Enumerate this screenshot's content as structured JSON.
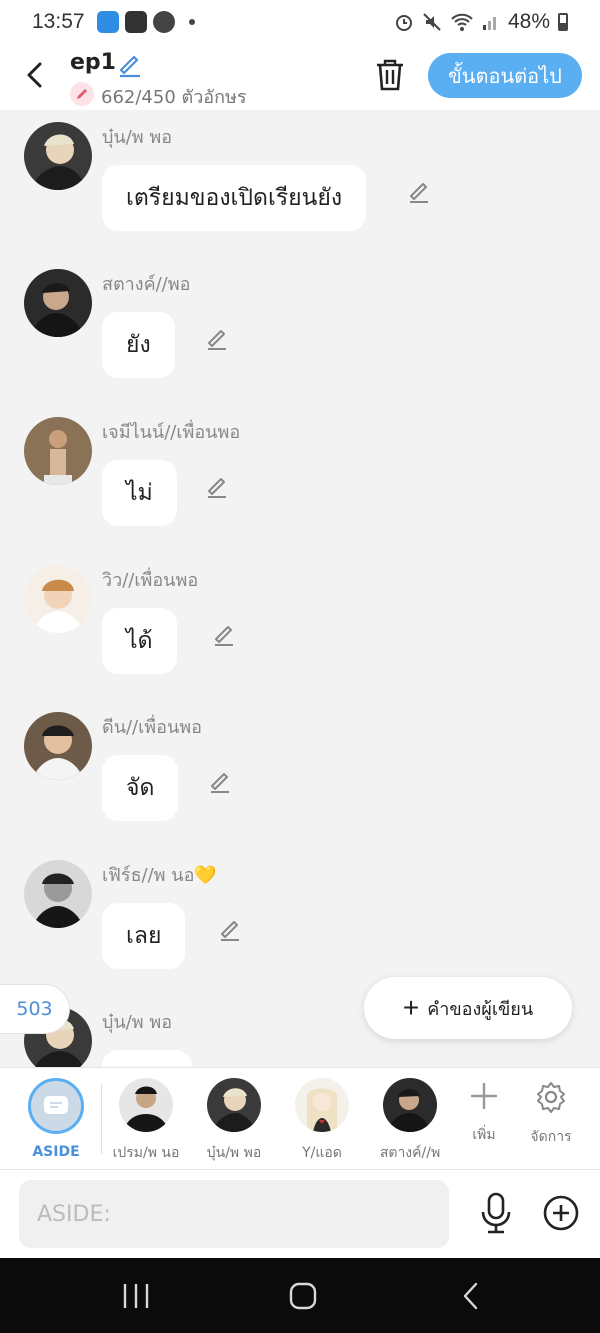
{
  "status_bar": {
    "time": "13:57",
    "battery": "48%"
  },
  "header": {
    "title": "ep1",
    "char_count": "662/450 ตัวอักษร",
    "next_label": "ขั้นตอนต่อไป"
  },
  "messages": [
    {
      "sender": "บุ๋น/พ พอ",
      "text": "เตรียมของเปิดเรียนยัง"
    },
    {
      "sender": "สตางค์//พอ",
      "text": "ยัง"
    },
    {
      "sender": "เจมีไนน์//เพื่อนพอ",
      "text": "ไม่"
    },
    {
      "sender": "วิว//เพื่อนพอ",
      "text": "ได้"
    },
    {
      "sender": "ดีน//เพื่อนพอ",
      "text": "จัด"
    },
    {
      "sender": "เฟิร์ธ//พ นอ💛",
      "text": "เลย"
    },
    {
      "sender": "บุ๋น/พ พอ",
      "text": ""
    }
  ],
  "counter_badge": "503",
  "writer_button_label": "คำของผู้เขียน",
  "characters": {
    "aside_label": "ASIDE",
    "items": [
      {
        "label": "เปรม/พ นอ"
      },
      {
        "label": "บุ๋น/พ พอ"
      },
      {
        "label": "Y/แอด"
      },
      {
        "label": "สตางค์//พ"
      }
    ],
    "add_label": "เพิ่ม",
    "manage_label": "จัดการ"
  },
  "input": {
    "placeholder": "ASIDE:",
    "value": ""
  },
  "colors": {
    "accent": "#5aaef2",
    "bubble": "#ffffff",
    "background": "#f3f3f3",
    "nav": "#0b0b0b"
  }
}
